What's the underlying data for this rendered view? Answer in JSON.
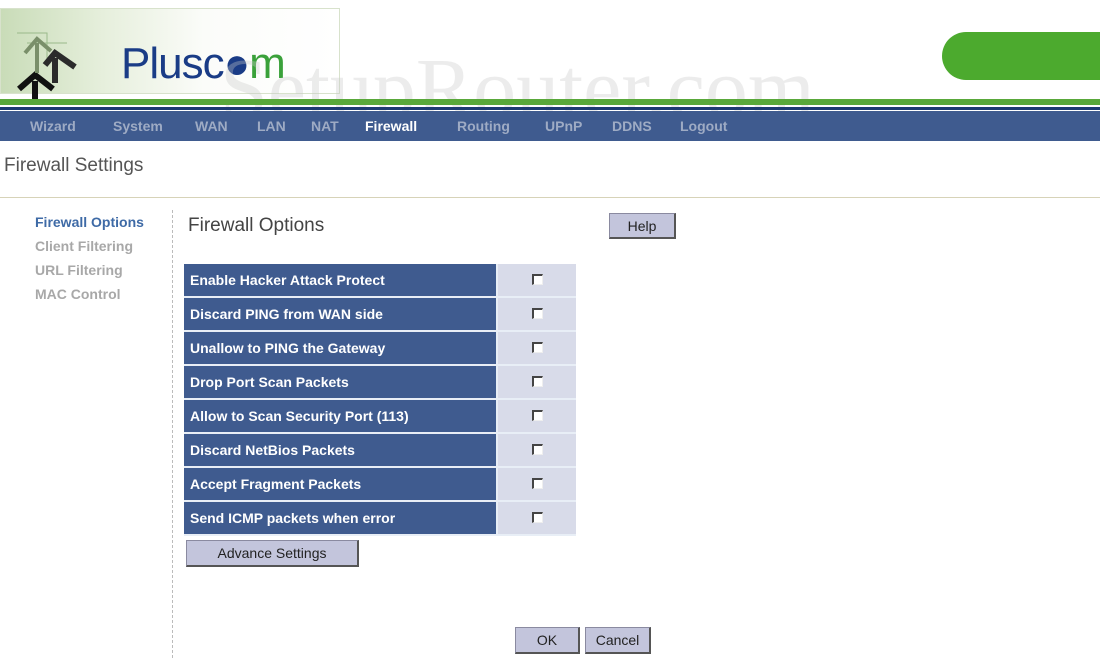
{
  "header": {
    "logo_text_main": "Plusc",
    "logo_text_o": "o",
    "logo_text_end": "m",
    "watermark": "SetupRouter.com"
  },
  "colors": {
    "nav_bg": "#3f5b8f",
    "brand_green": "#4caa2e",
    "brand_blue": "#1a3c86",
    "active_sidebar": "#3e6aa6"
  },
  "nav": {
    "items": [
      {
        "label": "Wizard"
      },
      {
        "label": "System"
      },
      {
        "label": "WAN"
      },
      {
        "label": "LAN"
      },
      {
        "label": "NAT"
      },
      {
        "label": "Firewall",
        "active": true
      },
      {
        "label": "Routing"
      },
      {
        "label": "UPnP"
      },
      {
        "label": "DDNS"
      },
      {
        "label": "Logout"
      }
    ]
  },
  "page": {
    "title": "Firewall Settings"
  },
  "sidebar": {
    "items": [
      {
        "label": "Firewall Options",
        "active": true
      },
      {
        "label": "Client Filtering"
      },
      {
        "label": "URL Filtering"
      },
      {
        "label": "MAC Control"
      }
    ]
  },
  "main": {
    "section_title": "Firewall Options",
    "help_label": "Help",
    "options": [
      {
        "label": "Enable Hacker Attack Protect",
        "checked": false
      },
      {
        "label": "Discard PING from WAN side",
        "checked": false
      },
      {
        "label": "Unallow to PING the Gateway",
        "checked": false
      },
      {
        "label": "Drop Port Scan Packets",
        "checked": false
      },
      {
        "label": "Allow to Scan Security Port (113)",
        "checked": false
      },
      {
        "label": "Discard NetBios Packets",
        "checked": false
      },
      {
        "label": "Accept Fragment Packets",
        "checked": false
      },
      {
        "label": "Send ICMP packets when error",
        "checked": false
      }
    ],
    "advance_label": "Advance Settings",
    "ok_label": "OK",
    "cancel_label": "Cancel"
  }
}
